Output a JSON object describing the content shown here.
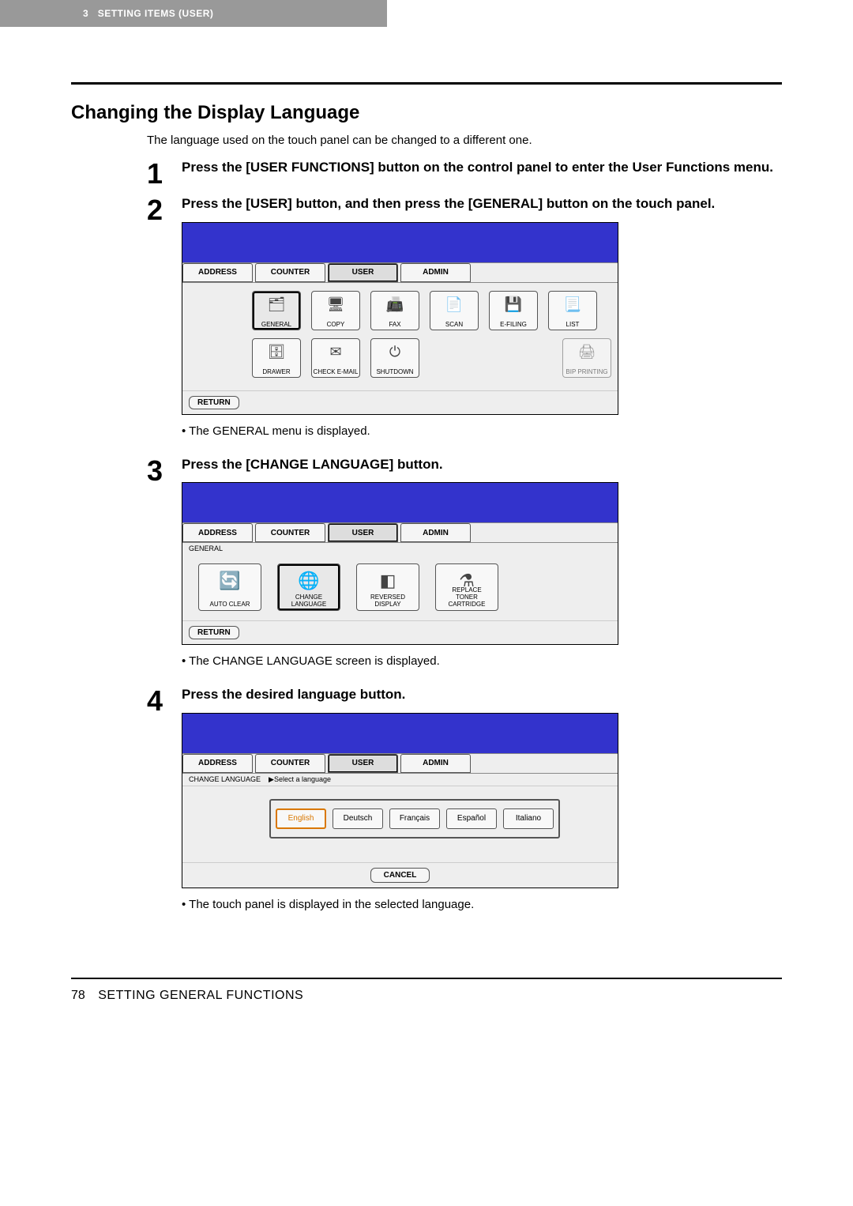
{
  "header": {
    "chapter_num": "3",
    "chapter_title": "SETTING ITEMS (USER)"
  },
  "section": {
    "title": "Changing the Display Language",
    "intro": "The language used on the touch panel can be changed to a different one."
  },
  "steps": [
    {
      "num": "1",
      "heading": "Press the [USER FUNCTIONS] button on the control panel to enter the User Functions menu."
    },
    {
      "num": "2",
      "heading": "Press the [USER] button, and then press the [GENERAL] button on the touch panel.",
      "note": "The GENERAL menu is displayed."
    },
    {
      "num": "3",
      "heading": "Press the [CHANGE LANGUAGE] button.",
      "note": "The CHANGE LANGUAGE screen is displayed."
    },
    {
      "num": "4",
      "heading": "Press the desired language button.",
      "note": "The touch panel is displayed in the selected language."
    }
  ],
  "panel_tabs": {
    "address": "ADDRESS",
    "counter": "COUNTER",
    "user": "USER",
    "admin": "ADMIN"
  },
  "panel1": {
    "row1": [
      {
        "label": "GENERAL",
        "glyph": "🗂",
        "pressed": true
      },
      {
        "label": "COPY",
        "glyph": "🖥",
        "pressed": false
      },
      {
        "label": "FAX",
        "glyph": "📠",
        "pressed": false
      },
      {
        "label": "SCAN",
        "glyph": "📄",
        "pressed": false
      },
      {
        "label": "E-FILING",
        "glyph": "💾",
        "pressed": false
      },
      {
        "label": "LIST",
        "glyph": "📃",
        "pressed": false
      }
    ],
    "row2": [
      {
        "label": "DRAWER",
        "glyph": "🗄",
        "pressed": false
      },
      {
        "label": "CHECK E-MAIL",
        "glyph": "✉",
        "pressed": false
      },
      {
        "label": "SHUTDOWN",
        "glyph": "⏻",
        "pressed": false
      }
    ],
    "row2_right": {
      "label": "BIP PRINTING",
      "glyph": "🖨"
    },
    "return": "RETURN"
  },
  "panel2": {
    "crumb": "GENERAL",
    "items": [
      {
        "label": "AUTO CLEAR",
        "glyph": "🔄",
        "pressed": false
      },
      {
        "label": "CHANGE\nLANGUAGE",
        "glyph": "🌐",
        "pressed": true
      },
      {
        "label": "REVERSED\nDISPLAY",
        "glyph": "◧",
        "pressed": false
      },
      {
        "label": "REPLACE\nTONER\nCARTRIDGE",
        "glyph": "⚗",
        "pressed": false
      }
    ],
    "return": "RETURN"
  },
  "panel3": {
    "crumb": "CHANGE LANGUAGE",
    "prompt": "▶Select a language",
    "languages": [
      {
        "label": "English",
        "selected": true
      },
      {
        "label": "Deutsch",
        "selected": false
      },
      {
        "label": "Français",
        "selected": false
      },
      {
        "label": "Español",
        "selected": false
      },
      {
        "label": "Italiano",
        "selected": false
      }
    ],
    "cancel": "CANCEL"
  },
  "footer": {
    "page": "78",
    "label": "SETTING GENERAL FUNCTIONS"
  }
}
